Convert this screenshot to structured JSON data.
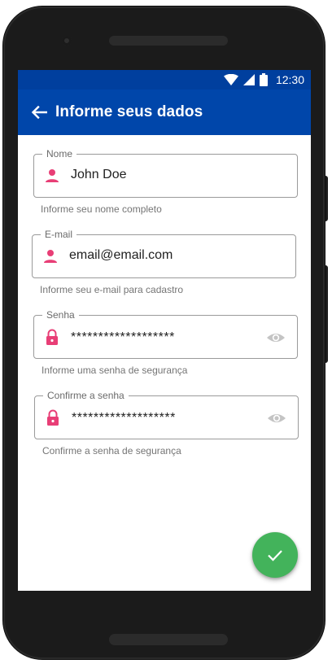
{
  "status_bar": {
    "time": "12:30",
    "icons": [
      "wifi-icon",
      "signal-icon",
      "battery-icon"
    ]
  },
  "app_bar": {
    "back_icon": "arrow-left-icon",
    "title": "Informe seus dados",
    "color": "#0046aa"
  },
  "form": {
    "name": {
      "label": "Nome",
      "value": "John Doe",
      "helper": "Informe seu nome completo",
      "icon": "person-icon"
    },
    "email": {
      "label": "E-mail",
      "value": "email@email.com",
      "helper": "Informe seu e-mail para cadastro",
      "icon": "person-icon"
    },
    "password": {
      "label": "Senha",
      "value": "*******************",
      "helper": "Informe uma senha de segurança",
      "icon": "lock-icon",
      "toggle_icon": "eye-icon"
    },
    "confirm_password": {
      "label": "Confirme a senha",
      "value": "*******************",
      "helper": "Confirme a senha de segurança",
      "icon": "lock-icon",
      "toggle_icon": "eye-icon"
    }
  },
  "fab": {
    "icon": "check-icon",
    "color": "#43b35b"
  },
  "colors": {
    "icon_accent": "#e83e76",
    "eye": "#c4c4c4"
  }
}
